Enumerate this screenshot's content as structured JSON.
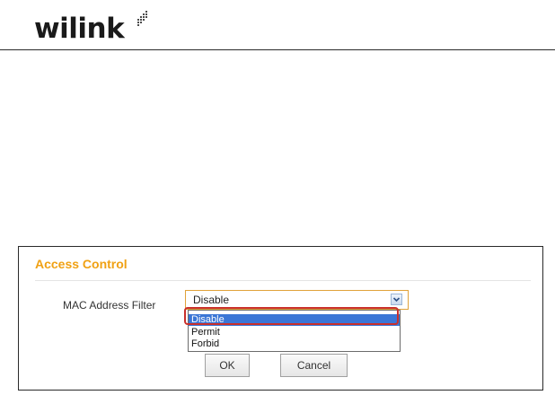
{
  "brand": {
    "logo_text": "wilink"
  },
  "panel": {
    "title": "Access Control",
    "mac_filter": {
      "label": "MAC Address Filter",
      "selected": "Disable",
      "options": [
        "Disable",
        "Permit",
        "Forbid"
      ],
      "highlighted_option": "Disable"
    },
    "buttons": {
      "ok": "OK",
      "cancel": "Cancel"
    }
  },
  "colors": {
    "title_accent": "#f0a114",
    "selection_blue": "#3b76d6",
    "annotation_red": "#c9302c"
  }
}
